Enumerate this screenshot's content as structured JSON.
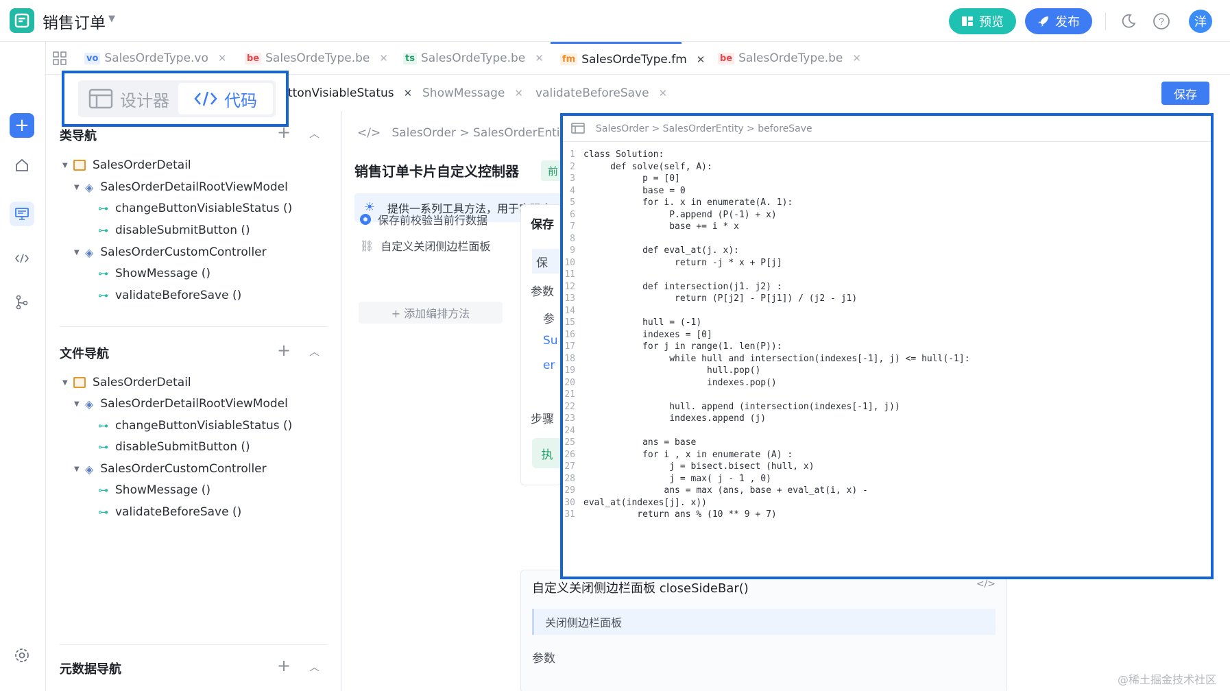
{
  "app": {
    "logo_icon": "form-app-icon",
    "title": "销售订单",
    "preview_label": "预览",
    "publish_label": "发布",
    "avatar_text": "洋"
  },
  "file_tabs": [
    {
      "badge": "vo",
      "name": "SalesOrdeType.vo"
    },
    {
      "badge": "be",
      "name": "SalesOrdeType.be"
    },
    {
      "badge": "ts",
      "name": "SalesOrdeType.be"
    },
    {
      "badge": "fm",
      "name": "SalesOrdeType.fm",
      "active": true
    },
    {
      "badge": "be",
      "name": "SalesOrdeType.be"
    }
  ],
  "sub_tabs": {
    "items": [
      "ttonVisiableStatus",
      "ShowMessage",
      "validateBeforeSave"
    ],
    "save_label": "保存"
  },
  "mode_switch": {
    "designer": "设计器",
    "code": "代码"
  },
  "class_nav": {
    "title": "类导航",
    "root": "SalesOrderDetail",
    "groups": [
      {
        "name": "SalesOrderDetailRootViewModel",
        "methods": [
          "changeButtonVisiableStatus  ()",
          "disableSubmitButton  ()"
        ]
      },
      {
        "name": "SalesOrderCustomController",
        "methods": [
          "ShowMessage  ()",
          "validateBeforeSave  ()"
        ]
      }
    ]
  },
  "file_nav": {
    "title": "文件导航",
    "root": "SalesOrderDetail",
    "groups": [
      {
        "name": "SalesOrderDetailRootViewModel",
        "methods": [
          "changeButtonVisiableStatus  ()",
          "disableSubmitButton  ()"
        ]
      },
      {
        "name": "SalesOrderCustomController",
        "methods": [
          "ShowMessage  ()",
          "validateBeforeSave  ()"
        ]
      }
    ]
  },
  "meta_nav": {
    "title": "元数据导航"
  },
  "content": {
    "breadcrumb": "SalesOrder > SalesOrderEntity",
    "title": "销售订单卡片自定义控制器",
    "tag": "前",
    "tip": "提供一系列工具方法，用于实现自",
    "steps": [
      "保存前校验当前行数据",
      "自定义关闭侧边栏面板"
    ],
    "add_method": "+ 添加编排方法",
    "card1": {
      "title": "保存",
      "desc": "保",
      "params": "参数",
      "param_head": "参",
      "row1": "Su",
      "row2": "er",
      "steps_label": "步骤",
      "exec": "执"
    },
    "card2": {
      "title": "自定义关闭侧边栏面板  closeSideBar()",
      "desc": "关闭侧边栏面板",
      "params": "参数"
    }
  },
  "code_panel": {
    "breadcrumb": "SalesOrder > SalesOrderEntity > beforeSave",
    "lines": [
      "class Solution:",
      "     def solve(self, A):",
      "           p = [0]",
      "           base = 0",
      "           for i. x in enumerate(A. 1):",
      "                P.append (P(-1) + x)",
      "                base += i * x",
      "",
      "           def eval_at(j. x):",
      "                 return -j * x + P[j]",
      "",
      "           def intersection(j1. j2) :",
      "                 return (P[j2] - P[j1]) / (j2 - j1)",
      "",
      "           hull = (-1)",
      "           indexes = [0]",
      "           for j in range(1. len(P)):",
      "                while hull and intersection(indexes[-1], j) <= hull(-1]:",
      "                       hull.pop()",
      "                       indexes.pop()",
      "",
      "                hull. append (intersection(indexes[-1], j))",
      "                indexes.append (j)",
      "",
      "           ans = base",
      "           for i , x in enumerate (A) :",
      "                j = bisect.bisect (hull, x)",
      "                j = max( j - 1 , 0)",
      "               ans = max (ans, base + eval_at(i, x) -",
      "eval_at(indexes[j]. x))",
      "          return ans % (10 ** 9 + 7)"
    ]
  },
  "watermark": "@稀土掘金技术社区"
}
